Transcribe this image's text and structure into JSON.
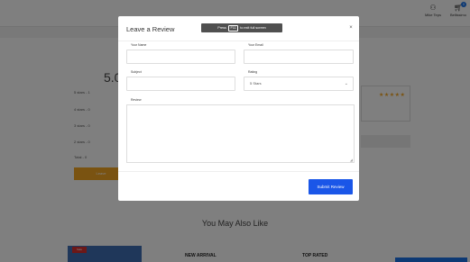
{
  "header": {
    "account_label": "Mike Teps",
    "cart_label": "Bellissimo",
    "cart_count": "0"
  },
  "background": {
    "rating_value": "5.0",
    "rating_rows": [
      "5 stars - 1",
      "4 stars - 0",
      "3 stars - 0",
      "2 stars - 0",
      "Total - 0"
    ],
    "write_review_label": "Leave",
    "stars": "★★★★★",
    "also_like_title": "You May Also Like",
    "sale_badge": "Sale",
    "new_arrival": "NEW ARRIVAL",
    "top_rated": "TOP RATED"
  },
  "modal": {
    "title": "Leave a Review",
    "close_glyph": "×",
    "fields": {
      "name_label": "Your Name",
      "email_label": "Your Email",
      "subject_label": "Subject",
      "rating_label": "Rating",
      "rating_value": "5 Stars",
      "review_label": "Review"
    },
    "submit_label": "Submit Review"
  },
  "fullscreen_toast": {
    "prefix": "Press",
    "key": "F11",
    "suffix": "to exit full screen"
  }
}
